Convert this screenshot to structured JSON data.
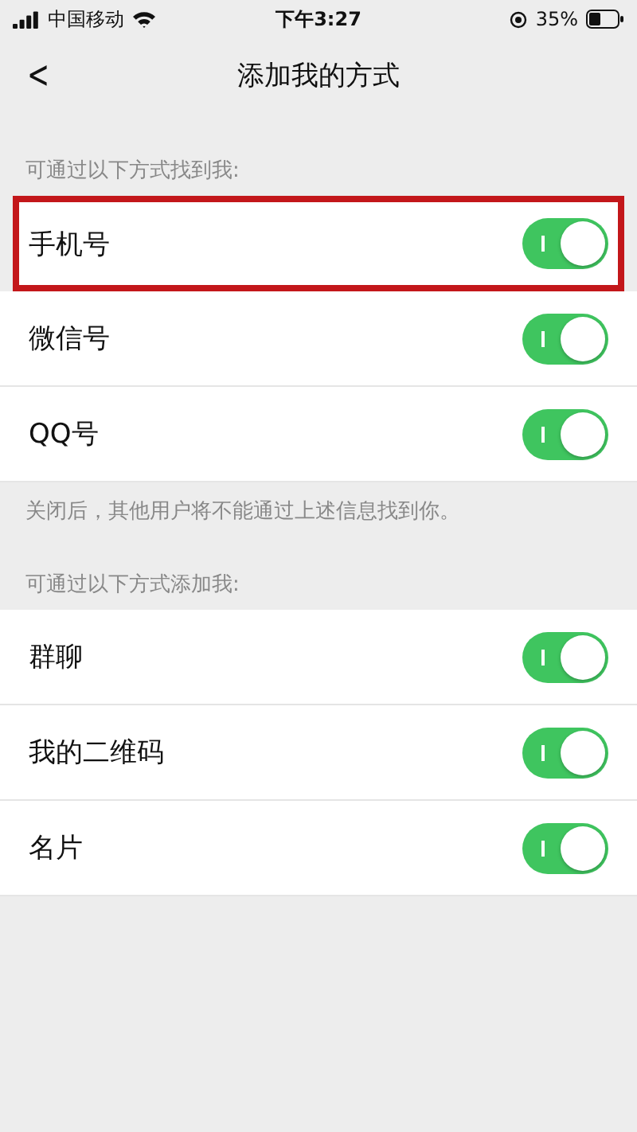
{
  "status_bar": {
    "carrier": "中国移动",
    "time": "下午3:27",
    "battery": "35%"
  },
  "nav": {
    "back": "<",
    "title": "添加我的方式"
  },
  "sections": [
    {
      "header": "可通过以下方式找到我:",
      "footer": "关闭后，其他用户将不能通过上述信息找到你。",
      "items": [
        {
          "label": "手机号",
          "on": true,
          "highlighted": true
        },
        {
          "label": "微信号",
          "on": true,
          "highlighted": false
        },
        {
          "label": "QQ号",
          "on": true,
          "highlighted": false
        }
      ]
    },
    {
      "header": "可通过以下方式添加我:",
      "items": [
        {
          "label": "群聊",
          "on": true,
          "highlighted": false
        },
        {
          "label": "我的二维码",
          "on": true,
          "highlighted": false
        },
        {
          "label": "名片",
          "on": true,
          "highlighted": false
        }
      ]
    }
  ]
}
